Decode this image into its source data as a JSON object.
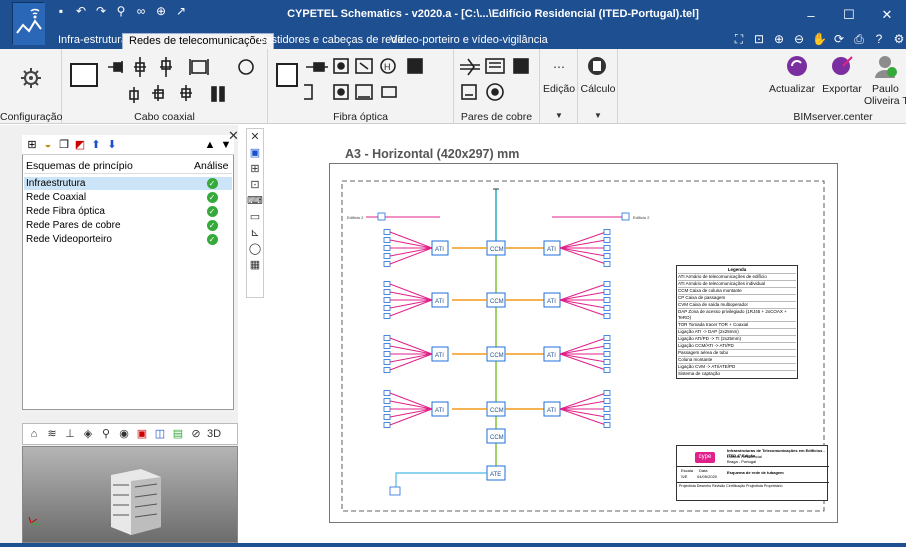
{
  "titlebar": {
    "title": "CYPETEL Schematics - v2020.a - [C:\\...\\Edifício Residencial (ITED-Portugal).tel]"
  },
  "tabs": [
    {
      "label": "Infra-estrutura",
      "active": false
    },
    {
      "label": "Redes de telecomunicações",
      "active": true
    },
    {
      "label": "Bastidores e cabeças de rede",
      "active": false
    },
    {
      "label": "Vídeo-porteiro e vídeo-vigilância",
      "active": false
    }
  ],
  "ribbon": {
    "groups": {
      "configuracao": "Configuração",
      "cabo_coaxial": "Cabo coaxial",
      "fibra_optica": "Fibra óptica",
      "pares_cobre": "Pares de cobre",
      "bimserver": "BIMserver.center"
    },
    "buttons": {
      "edicao": "Edição",
      "calculo": "Cálculo",
      "actualizar": "Actualizar",
      "exportar": "Exportar",
      "user_first": "Paulo",
      "user_last": "Oliveira TOR"
    }
  },
  "schemes": {
    "header_name": "Esquemas de princípio",
    "header_analysis": "Análise",
    "rows": [
      {
        "name": "Infraestrutura",
        "ok": true,
        "selected": true
      },
      {
        "name": "Rede Coaxial",
        "ok": true,
        "selected": false
      },
      {
        "name": "Rede Fibra óptica",
        "ok": true,
        "selected": false
      },
      {
        "name": "Rede Pares de cobre",
        "ok": true,
        "selected": false
      },
      {
        "name": "Rede Videoporteiro",
        "ok": true,
        "selected": false
      }
    ]
  },
  "sheet": {
    "title": "A3 - Horizontal (420x297) mm"
  },
  "drawing": {
    "ati_label": "ATI",
    "ccm_label": "CCM",
    "ate_label": "ATE",
    "tl_label": "Edifício 2",
    "tr_label": "Edifício 2",
    "legend_title": "Legenda",
    "legend_items": [
      "ATI Armário de telecomunicações de edifício",
      "ATI Armário de telecomunicações individual",
      "CCM Caixa de coluna montante",
      "CP Caixa de passagem",
      "CVM Caixa de saída multioperador",
      "DAP Zona de acesso privilegiado (1RJ45 + 2xCOAX + TeRO)",
      "TOR Tomada tracer TOR + Coaxial",
      "Ligação ATI -> DAP (2x25mm)",
      "Ligação ATI/PD -> TI (2x25mm)",
      "Ligação CCM/ATI -> ATI/PD",
      "Passagem aérea de tubo",
      "Coluna montante",
      "Ligação CVM -> ATI/ATE/PD",
      "Sistema de captação"
    ],
    "logo_text": "cype",
    "titleblock_title": "Infraestruturas de Telecomunicações em Edifícios - ITED 4ª Edição",
    "titleblock_sub1": "Edifício Residencial",
    "titleblock_sub2": "Braga - Portugal",
    "titleblock_scheme": "Esquema de rede de tubagem",
    "titleblock_scale_label": "Escala",
    "titleblock_scale": "S/E",
    "titleblock_date_label": "Data",
    "titleblock_date": "04/05/2020",
    "titleblock_footer": "Projectista  Desenho  Revisão  Certificação Projectista  Proprietário"
  },
  "colors": {
    "titlebar": "#1e4f91",
    "ribbon": "#f3f3f3",
    "magenta": "#e0218a",
    "orange": "#f39a1e",
    "green": "#8cc63f",
    "blue": "#1e6fd9",
    "cyan": "#49b9e6",
    "check": "#35a93a"
  }
}
